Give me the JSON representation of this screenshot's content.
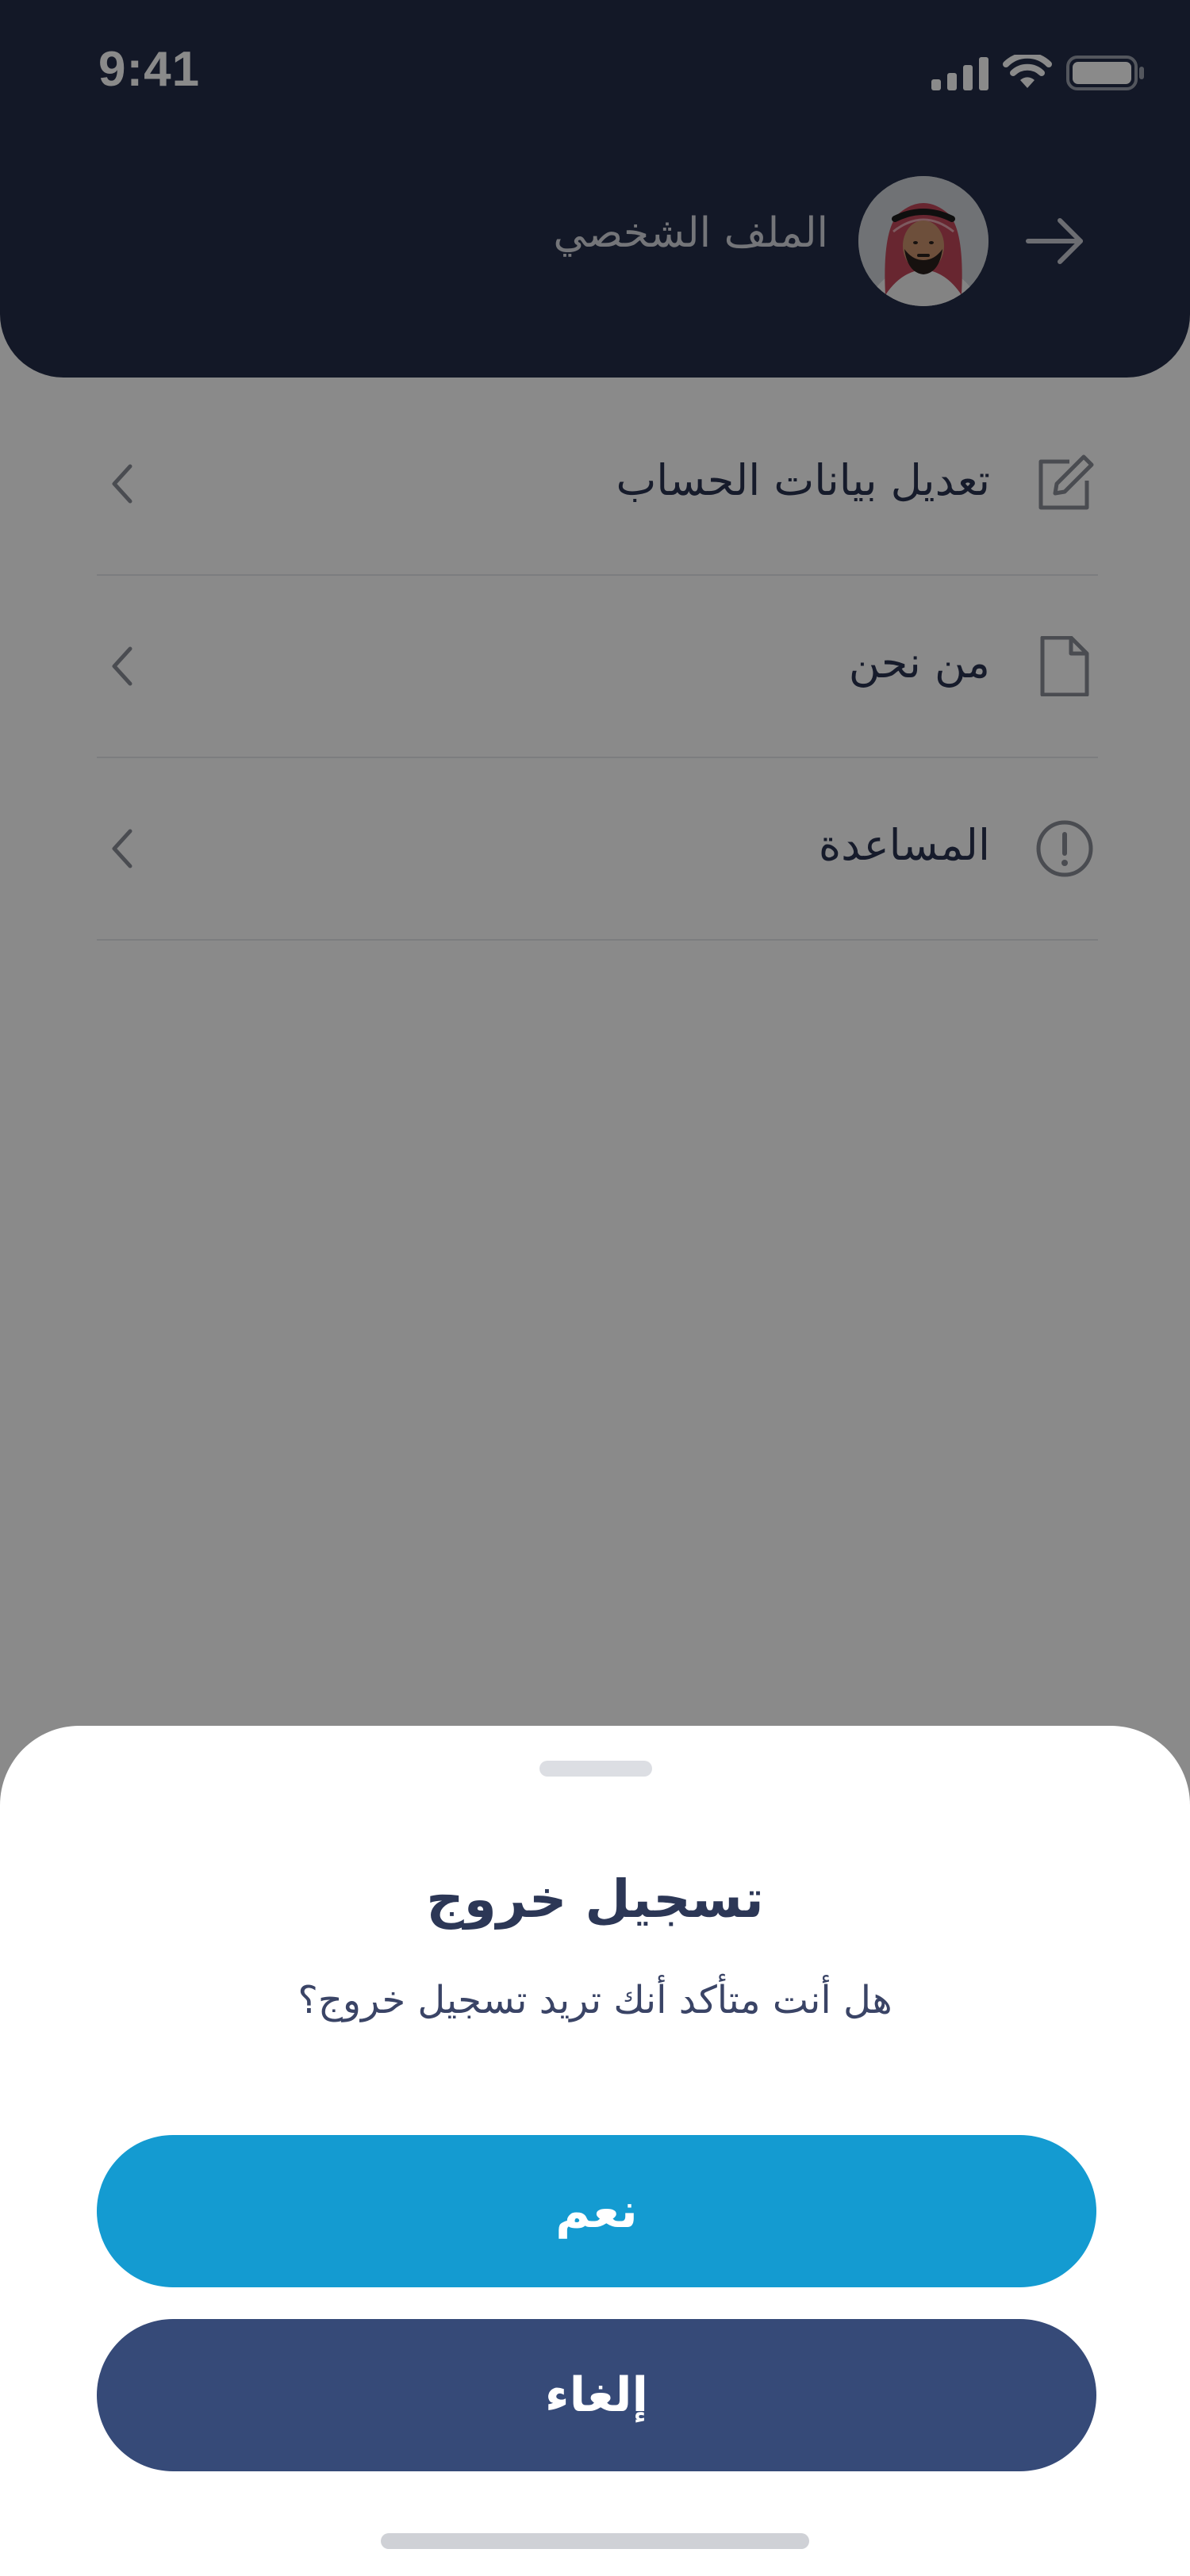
{
  "status_bar": {
    "time": "9:41",
    "icons": [
      "signal-icon",
      "wifi-icon",
      "battery-icon"
    ]
  },
  "header": {
    "title": "الملف الشخصي",
    "back_icon": "arrow-right-icon",
    "avatar": "profile-avatar"
  },
  "menu": {
    "items": [
      {
        "label": "تعديل بيانات الحساب",
        "icon": "edit-icon",
        "chevron": "chevron-left-icon"
      },
      {
        "label": "من نحن",
        "icon": "document-icon",
        "chevron": "chevron-left-icon"
      },
      {
        "label": "المساعدة",
        "icon": "info-circle-icon",
        "chevron": "chevron-left-icon"
      }
    ]
  },
  "dialog": {
    "title": "تسجيل خروج",
    "message": "هل أنت متأكد أنك تريد تسجيل خروج؟",
    "confirm_label": "نعم",
    "cancel_label": "إلغاء"
  },
  "colors": {
    "header_bg": "#242d48",
    "primary_button": "#149bd1",
    "secondary_button": "#364a78",
    "overlay": "rgba(0,0,0,0.46)"
  }
}
